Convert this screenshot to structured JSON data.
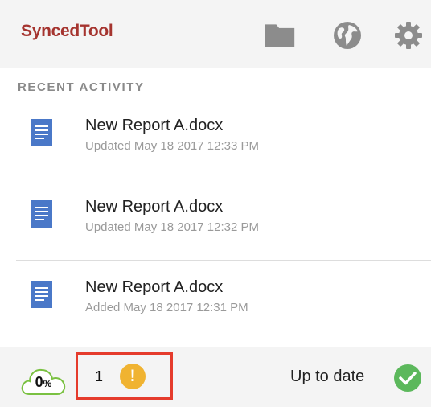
{
  "header": {
    "brand": "SyncedTool",
    "icons": [
      "folder-icon",
      "globe-icon",
      "gear-icon"
    ]
  },
  "activity": {
    "section_title": "RECENT ACTIVITY",
    "items": [
      {
        "icon": "document-icon",
        "name": "New Report A.docx",
        "meta": "Updated May 18 2017 12:33 PM"
      },
      {
        "icon": "document-icon",
        "name": "New Report A.docx",
        "meta": "Updated May 18 2017 12:32 PM"
      },
      {
        "icon": "document-icon",
        "name": "New Report A.docx",
        "meta": "Added May 18 2017 12:31 PM"
      }
    ]
  },
  "footer": {
    "sync_percent": "0",
    "sync_percent_unit": "%",
    "alert_count": "1",
    "warning_symbol": "!",
    "status": "Up to date"
  },
  "colors": {
    "brand": "#a5342f",
    "doc_icon": "#4a78c8",
    "warning": "#f0b331",
    "success": "#5cb85c",
    "highlight_border": "#e53b2c"
  }
}
